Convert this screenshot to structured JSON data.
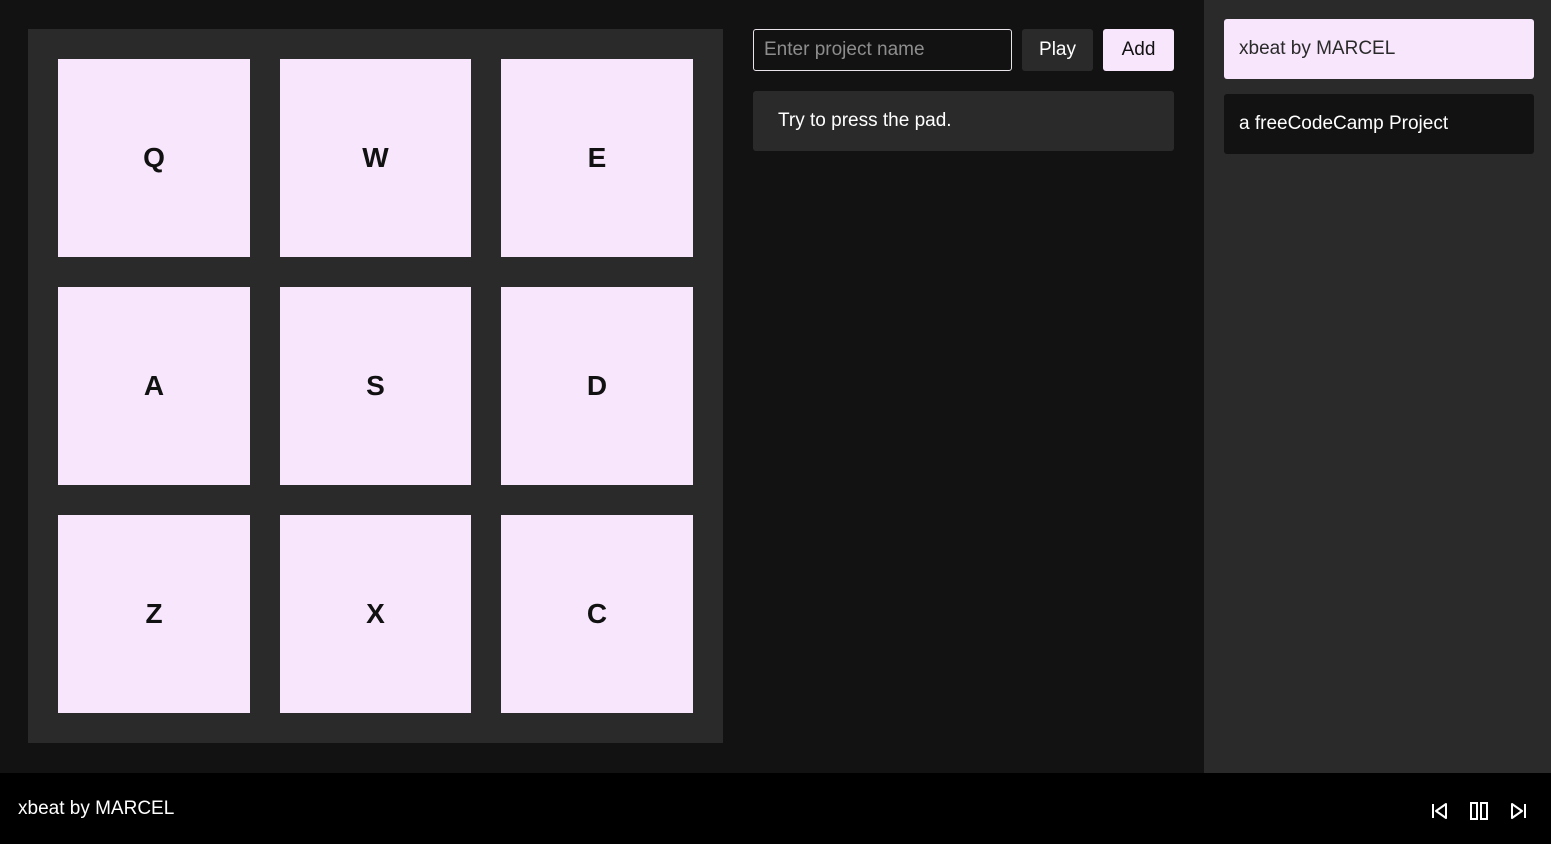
{
  "pads": [
    "Q",
    "W",
    "E",
    "A",
    "S",
    "D",
    "Z",
    "X",
    "C"
  ],
  "toolbar": {
    "project_placeholder": "Enter project name",
    "play_label": "Play",
    "add_label": "Add"
  },
  "message": "Try to press the pad.",
  "sidebar": {
    "items": [
      {
        "label": "xbeat by MARCEL",
        "active": true
      },
      {
        "label": "a freeCodeCamp Project",
        "active": false
      }
    ]
  },
  "footer": {
    "title": "xbeat by MARCEL",
    "controls": [
      "skip-previous-icon",
      "pause-icon",
      "skip-next-icon"
    ]
  },
  "colors": {
    "accent": "#f8e6fd",
    "background": "#121212",
    "panel": "#2a2a2a",
    "footer": "#000000"
  }
}
